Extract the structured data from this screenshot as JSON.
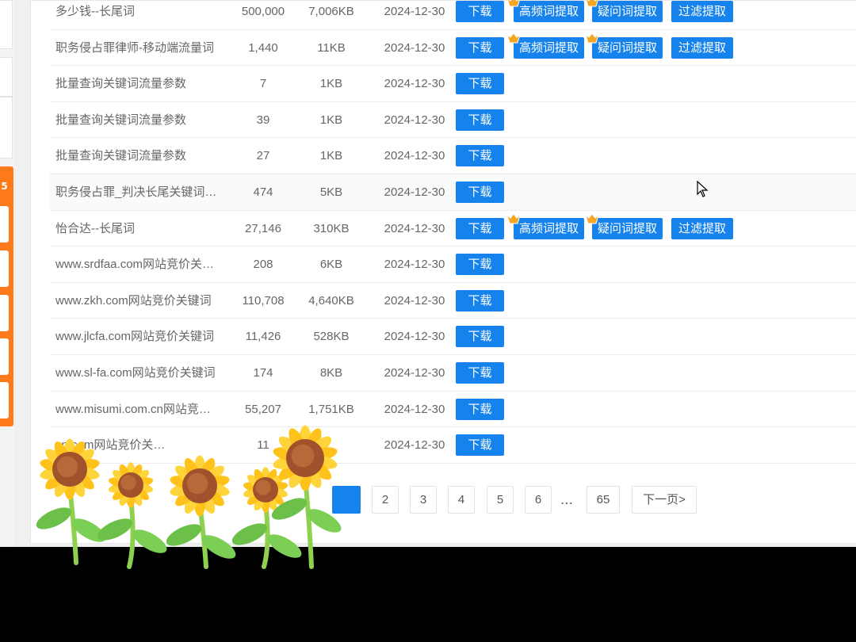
{
  "rows": [
    {
      "name": "多少钱--长尾词",
      "count": "500,000",
      "size": "7,006KB",
      "date": "2024-12-30",
      "extra": true
    },
    {
      "name": "职务侵占罪律师-移动端流量词",
      "count": "1,440",
      "size": "11KB",
      "date": "2024-12-30",
      "extra": true
    },
    {
      "name": "批量查询关键词流量参数",
      "count": "7",
      "size": "1KB",
      "date": "2024-12-30",
      "extra": false
    },
    {
      "name": "批量查询关键词流量参数",
      "count": "39",
      "size": "1KB",
      "date": "2024-12-30",
      "extra": false
    },
    {
      "name": "批量查询关键词流量参数",
      "count": "27",
      "size": "1KB",
      "date": "2024-12-30",
      "extra": false
    },
    {
      "name": "职务侵占罪_判决长尾关键词…",
      "count": "474",
      "size": "5KB",
      "date": "2024-12-30",
      "extra": false
    },
    {
      "name": "怡合达--长尾词",
      "count": "27,146",
      "size": "310KB",
      "date": "2024-12-30",
      "extra": true
    },
    {
      "name": "www.srdfaa.com网站竞价关…",
      "count": "208",
      "size": "6KB",
      "date": "2024-12-30",
      "extra": false
    },
    {
      "name": "www.zkh.com网站竞价关键词",
      "count": "110,708",
      "size": "4,640KB",
      "date": "2024-12-30",
      "extra": false
    },
    {
      "name": "www.jlcfa.com网站竞价关键词",
      "count": "11,426",
      "size": "528KB",
      "date": "2024-12-30",
      "extra": false
    },
    {
      "name": "www.sl-fa.com网站竞价关键词",
      "count": "174",
      "size": "8KB",
      "date": "2024-12-30",
      "extra": false
    },
    {
      "name": "www.misumi.com.cn网站竞…",
      "count": "55,207",
      "size": "1,751KB",
      "date": "2024-12-30",
      "extra": false
    },
    {
      "name": "cn.com网站竞价关…",
      "count": "11",
      "size": "",
      "date": "2024-12-30",
      "extra": false
    }
  ],
  "actions": {
    "download": "下载",
    "high_freq": "高频词提取",
    "question": "疑问词提取",
    "filter": "过滤提取"
  },
  "pagination": {
    "pages": [
      "2",
      "3",
      "4",
      "5",
      "6"
    ],
    "ellipsis": "…",
    "last": "65",
    "next": "下一页>"
  },
  "sidebar": {
    "badge": "5"
  },
  "colors": {
    "primary": "#1683ec",
    "orange": "#ff7a1a"
  }
}
